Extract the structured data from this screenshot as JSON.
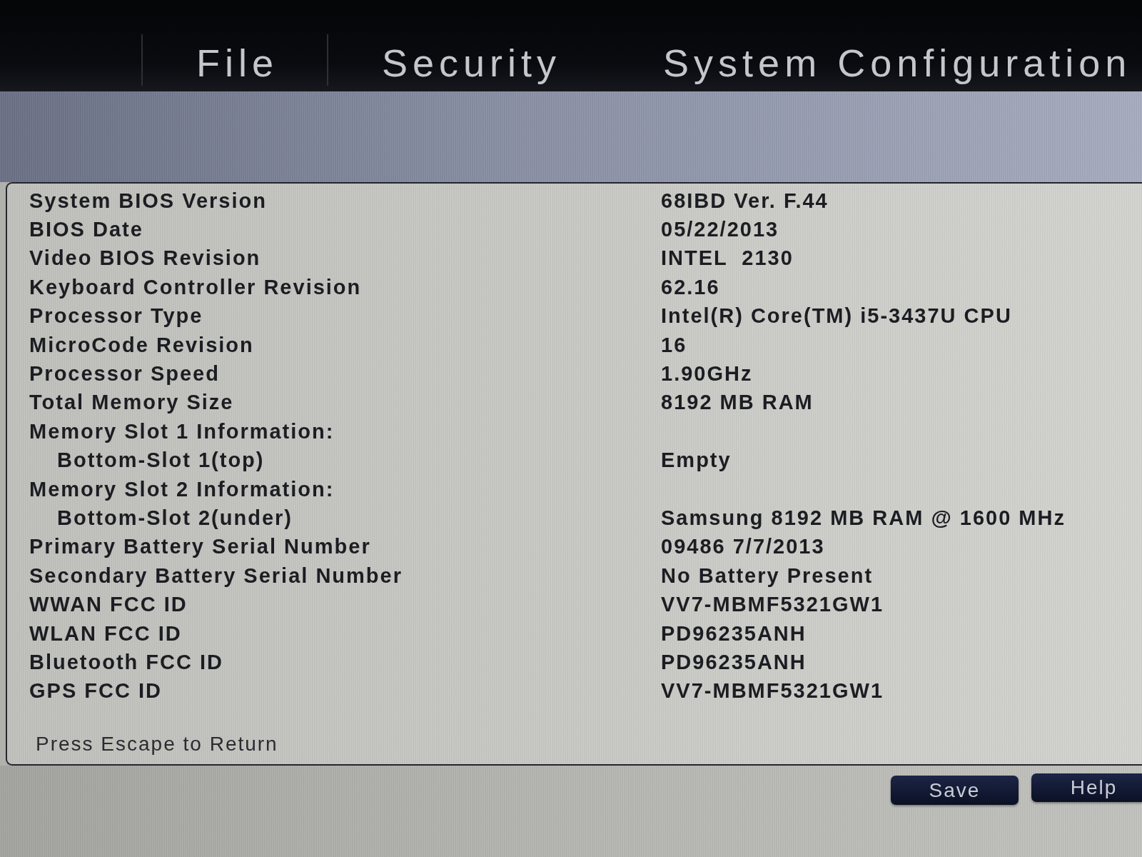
{
  "menu_bar": {
    "items": [
      {
        "label": "File",
        "selected": false
      },
      {
        "label": "Security",
        "selected": false
      },
      {
        "label": "System Configuration",
        "selected": false
      }
    ]
  },
  "system_information": {
    "rows": [
      {
        "label": "System BIOS Version",
        "value": "68IBD Ver. F.44"
      },
      {
        "label": "BIOS Date",
        "value": "05/22/2013"
      },
      {
        "label": "Video BIOS Revision",
        "value": "INTEL  2130"
      },
      {
        "label": "Keyboard Controller Revision",
        "value": "62.16"
      },
      {
        "label": "Processor Type",
        "value": "Intel(R) Core(TM) i5-3437U CPU"
      },
      {
        "label": "MicroCode Revision",
        "value": "16"
      },
      {
        "label": "Processor Speed",
        "value": "1.90GHz"
      },
      {
        "label": "Total Memory Size",
        "value": "8192 MB RAM"
      },
      {
        "label": "Memory Slot 1 Information:",
        "children": [
          {
            "label": "Bottom-Slot 1(top)",
            "value": "Empty"
          }
        ]
      },
      {
        "label": "Memory Slot 2 Information:",
        "children": [
          {
            "label": "Bottom-Slot 2(under)",
            "value": "Samsung 8192 MB RAM @ 1600 MHz"
          }
        ]
      },
      {
        "label": "Primary Battery Serial Number",
        "value": "09486 7/7/2013"
      },
      {
        "label": "Secondary Battery Serial Number",
        "value": "No Battery Present"
      },
      {
        "label": "WWAN FCC ID",
        "value": "VV7-MBMF5321GW1"
      },
      {
        "label": "WLAN FCC ID",
        "value": "PD96235ANH"
      },
      {
        "label": "Bluetooth FCC ID",
        "value": "PD96235ANH"
      },
      {
        "label": "GPS FCC ID",
        "value": "VV7-MBMF5321GW1"
      }
    ],
    "hint": "Press Escape to Return"
  },
  "buttons": [
    {
      "label": "Save"
    },
    {
      "label": "Help"
    }
  ]
}
